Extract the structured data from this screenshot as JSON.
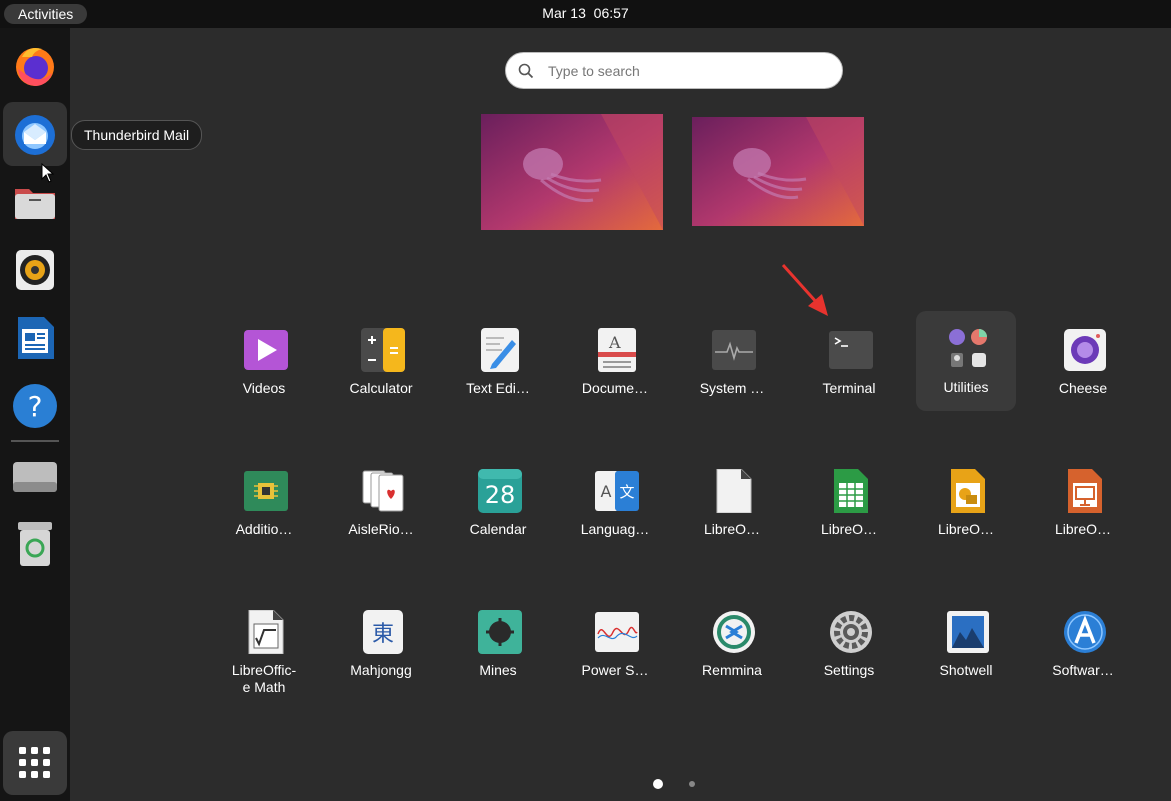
{
  "topbar": {
    "activities": "Activities",
    "date": "Mar 13",
    "time": "06:57"
  },
  "dock": {
    "tooltip": "Thunderbird Mail",
    "items": [
      {
        "name": "firefox-icon"
      },
      {
        "name": "thunderbird-icon"
      },
      {
        "name": "files-icon"
      },
      {
        "name": "rhythmbox-icon"
      },
      {
        "name": "libreoffice-writer-icon"
      },
      {
        "name": "help-icon"
      },
      {
        "name": "drive-icon"
      },
      {
        "name": "trash-icon"
      },
      {
        "name": "show-apps-icon"
      }
    ]
  },
  "search": {
    "placeholder": "Type to search"
  },
  "apps": [
    {
      "label": "Videos"
    },
    {
      "label": "Calculator"
    },
    {
      "label": "Text Edi…"
    },
    {
      "label": "Docume…"
    },
    {
      "label": "System …"
    },
    {
      "label": "Terminal"
    },
    {
      "label": "Utilities"
    },
    {
      "label": "Cheese"
    },
    {
      "label": "Additio…"
    },
    {
      "label": "AisleRio…"
    },
    {
      "label": "Calendar"
    },
    {
      "label": "Languag…"
    },
    {
      "label": "LibreO…"
    },
    {
      "label": "LibreO…"
    },
    {
      "label": "LibreO…"
    },
    {
      "label": "LibreO…"
    },
    {
      "label": "LibreOffic-\ne Math"
    },
    {
      "label": "Mahjongg"
    },
    {
      "label": "Mines"
    },
    {
      "label": "Power S…"
    },
    {
      "label": "Remmina"
    },
    {
      "label": "Settings"
    },
    {
      "label": "Shotwell"
    },
    {
      "label": "Softwar…"
    }
  ],
  "calendar_day": "28",
  "mahjongg_glyph": "東",
  "language_glyphs": [
    "A",
    "文"
  ],
  "pages": {
    "current": 1,
    "total": 2
  },
  "colors": {
    "accent": "#e95420",
    "arrow": "#e8332e"
  }
}
